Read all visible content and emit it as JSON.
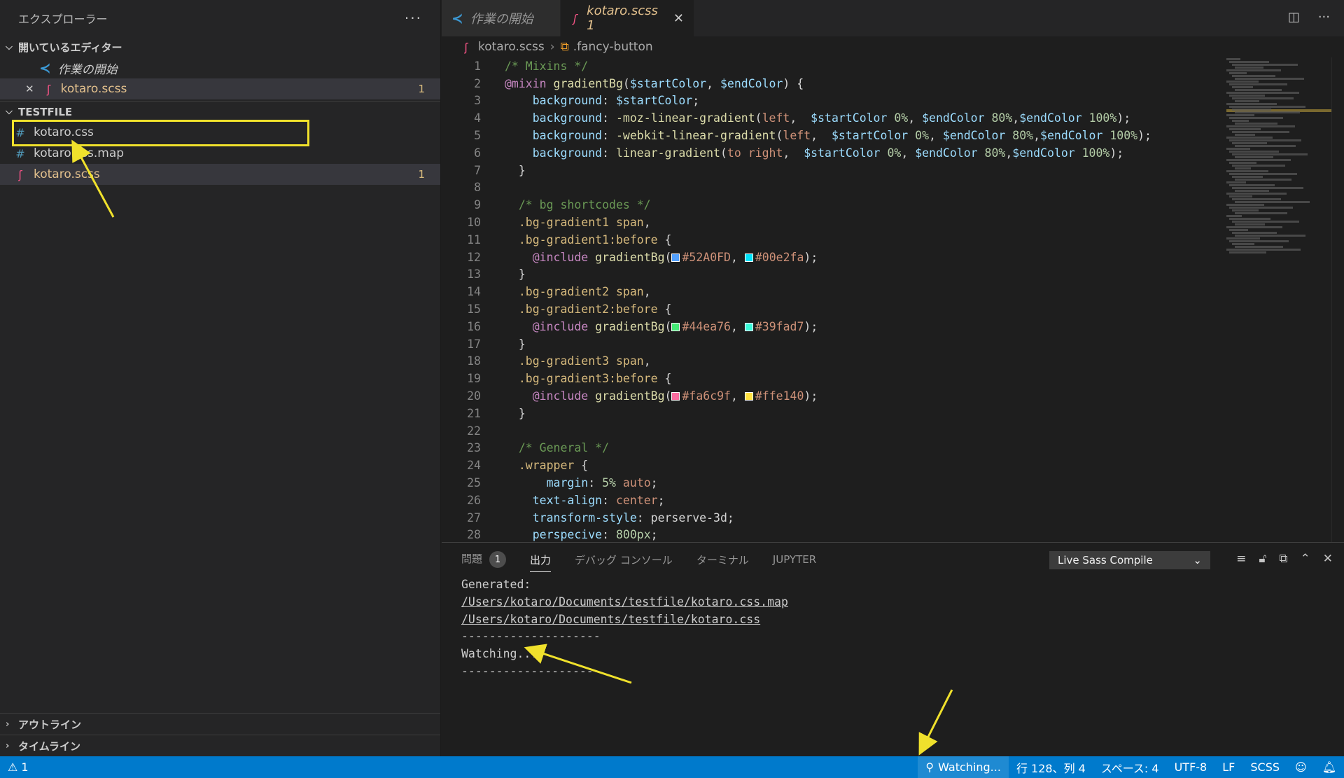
{
  "sidebar": {
    "title": "エクスプローラー",
    "more": "···",
    "open_editors": {
      "label": "開いているエディター",
      "items": [
        {
          "name": "作業の開始",
          "icon": "vscode-icon"
        },
        {
          "name": "kotaro.scss",
          "icon": "sass-icon",
          "close": "✕",
          "count": "1"
        }
      ]
    },
    "folder": {
      "label": "TESTFILE",
      "files": [
        {
          "name": "kotaro.css",
          "icon": "#"
        },
        {
          "name": "kotaro.css.map",
          "icon": "#"
        },
        {
          "name": "kotaro.scss",
          "icon": "sass-icon",
          "count": "1"
        }
      ]
    },
    "outline_label": "アウトライン",
    "timeline_label": "タイムライン"
  },
  "tabs": [
    {
      "label": "作業の開始",
      "active": false
    },
    {
      "label": "kotaro.scss 1",
      "active": true,
      "close": "✕"
    }
  ],
  "breadcrumb": {
    "file": "kotaro.scss",
    "symbol": ".fancy-button"
  },
  "code": {
    "line_numbers": [
      "1",
      "2",
      "3",
      "4",
      "5",
      "6",
      "7",
      "8",
      "9",
      "10",
      "11",
      "12",
      "13",
      "14",
      "15",
      "16",
      "17",
      "18",
      "19",
      "20",
      "21",
      "22",
      "23",
      "24",
      "25",
      "26",
      "27",
      "28"
    ],
    "swatches": {
      "c1": "#52A0FD",
      "c2": "#00e2fa",
      "c3": "#44ea76",
      "c4": "#39fad7",
      "c5": "#fa6c9f",
      "c6": "#ffe140"
    }
  },
  "panel": {
    "tabs": [
      {
        "label": "問題",
        "badge": "1"
      },
      {
        "label": "出力",
        "active": true
      },
      {
        "label": "デバッグ コンソール"
      },
      {
        "label": "ターミナル"
      },
      {
        "label": "JUPYTER"
      }
    ],
    "output_channel": "Live Sass Compile",
    "output_lines": [
      "Generated:",
      "/Users/kotaro/Documents/testfile/kotaro.css.map",
      "/Users/kotaro/Documents/testfile/kotaro.css",
      "--------------------",
      "Watching...",
      "--------------------"
    ]
  },
  "statusbar": {
    "problems": "⚠ 1",
    "watching": "Watching...",
    "position": "行 128、列 4",
    "spaces": "スペース: 4",
    "encoding": "UTF-8",
    "eol": "LF",
    "language": "SCSS"
  },
  "colors": {
    "accent": "#007acc",
    "annotation": "#f0e12c",
    "modified": "#e2c08d"
  }
}
